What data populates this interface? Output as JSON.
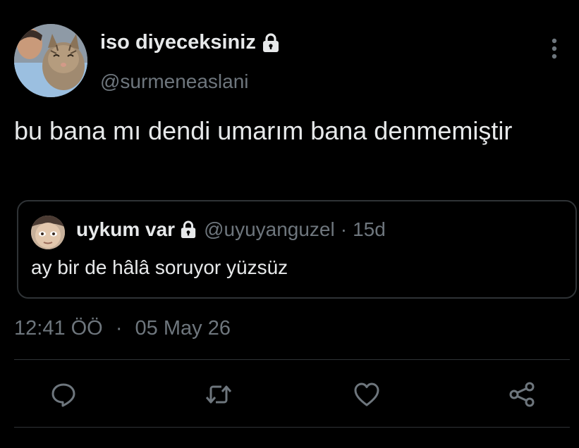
{
  "tweet": {
    "author": {
      "display_name": "iso diyeceksiniz",
      "handle": "@surmeneaslani",
      "protected": true,
      "avatar": "avatar-person-with-cat"
    },
    "text": "bu bana mı dendi umarım bana denmemiştir",
    "quoted": {
      "display_name": "uykum var",
      "protected": true,
      "handle": "@uyuyanguzel",
      "separator": "·",
      "time": "15d",
      "text": "ay bir de hâlâ soruyor yüzsüz",
      "avatar": "avatar-face"
    },
    "meta": {
      "time": "12:41 ÖÖ",
      "separator": "·",
      "date": "05 May 26"
    },
    "actions": [
      {
        "name": "reply",
        "icon": "reply-icon"
      },
      {
        "name": "retweet",
        "icon": "retweet-icon"
      },
      {
        "name": "like",
        "icon": "heart-icon"
      },
      {
        "name": "share",
        "icon": "share-icon"
      }
    ]
  },
  "icons": {
    "lock": "lock-icon",
    "more": "more-vertical-icon"
  },
  "colors": {
    "background": "#000000",
    "text_primary": "#e7e9ea",
    "text_secondary": "#6e767d",
    "border": "#2f3336"
  }
}
